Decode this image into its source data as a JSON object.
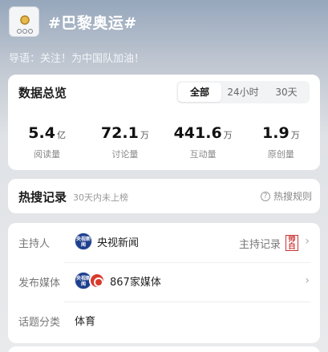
{
  "header": {
    "title": "#巴黎奥运#",
    "guide": "导语：关注！为中国队加油！",
    "logo_icon": "paris-olympics-logo"
  },
  "overview": {
    "title": "数据总览",
    "tabs": [
      {
        "label": "全部",
        "active": true
      },
      {
        "label": "24小时",
        "active": false
      },
      {
        "label": "30天",
        "active": false
      }
    ],
    "stats": [
      {
        "value": "5.4",
        "unit": "亿",
        "label": "阅读量"
      },
      {
        "value": "72.1",
        "unit": "万",
        "label": "讨论量"
      },
      {
        "value": "441.6",
        "unit": "万",
        "label": "互动量"
      },
      {
        "value": "1.9",
        "unit": "万",
        "label": "原创量"
      }
    ]
  },
  "hot": {
    "title": "热搜记录",
    "subtitle": "30天内未上榜",
    "rule_label": "热搜规则"
  },
  "info": {
    "host": {
      "label": "主持人",
      "name": "央视新闻",
      "record_label": "主持记录",
      "avatar_text": "央视新闻"
    },
    "media": {
      "label": "发布媒体",
      "count": "867家媒体",
      "avatar_text": "央视新闻"
    },
    "category": {
      "label": "话题分类",
      "value": "体育"
    }
  },
  "colors": {
    "cctv_blue": "#1e3f8f",
    "red_logo": "#d93a2b",
    "header_bg": "#96a7bc"
  }
}
